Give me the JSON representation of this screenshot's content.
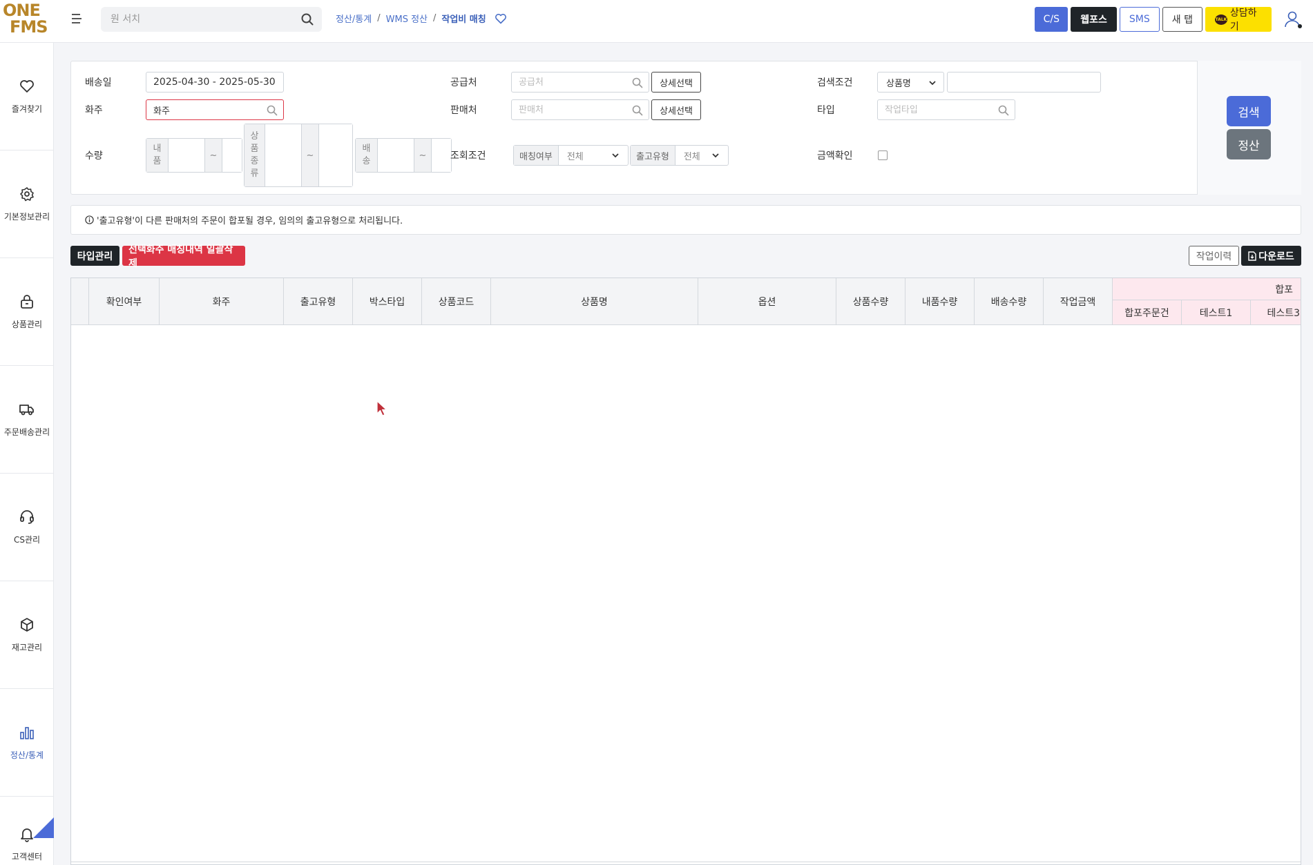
{
  "logo": {
    "line1": "ONE",
    "line2": "FMS"
  },
  "search": {
    "placeholder": "원 서치"
  },
  "breadcrumb": {
    "level1": "정산/통계",
    "level2": "WMS 정산",
    "current": "작업비 매칭",
    "sep": "/"
  },
  "header_buttons": {
    "cs": "C/S",
    "webpos": "웹포스",
    "sms": "SMS",
    "newtab": "새 탭",
    "kakao": "상담하기",
    "kakao_badge": "TALK"
  },
  "sidebar": {
    "items": [
      {
        "label": "즐겨찾기",
        "icon": "heart-icon"
      },
      {
        "label": "기본정보관리",
        "icon": "gear-icon"
      },
      {
        "label": "상품관리",
        "icon": "lock-bag-icon"
      },
      {
        "label": "주문배송관리",
        "icon": "truck-icon"
      },
      {
        "label": "CS관리",
        "icon": "headset-icon"
      },
      {
        "label": "재고관리",
        "icon": "box-icon"
      },
      {
        "label": "정산/통계",
        "icon": "bar-chart-icon",
        "active": true
      },
      {
        "label": "고객센터",
        "icon": "bell-icon"
      }
    ]
  },
  "filters": {
    "ship_date_label": "배송일",
    "ship_date_value": "2025-04-30 - 2025-05-30",
    "owner_label": "화주",
    "owner_value": "화주",
    "qty_label": "수량",
    "qty_return": "내품",
    "qty_product_kind": "상품종류",
    "qty_ship": "배송",
    "tilde": "~",
    "supplier_label": "공급처",
    "supplier_placeholder": "공급처",
    "seller_label": "판매처",
    "seller_placeholder": "판매처",
    "detail_select": "상세선택",
    "query_label": "조회조건",
    "matching_label": "매칭여부",
    "matching_value": "전체",
    "out_type_label": "출고유형",
    "out_type_value": "전체",
    "search_cond_label": "검색조건",
    "search_cond_value": "상품명",
    "type_label": "타입",
    "type_placeholder": "작업타입",
    "amount_check_label": "금액확인"
  },
  "actions": {
    "search": "검색",
    "settle": "정산"
  },
  "notice": "'출고유형'이 다른 판매처의 주문이 합포될 경우, 임의의 출고유형으로 처리됩니다.",
  "toolbar": {
    "type_mgmt": "타입관리",
    "bulk_delete": "선택화주 매칭내역 일괄삭제",
    "history": "작업이력",
    "download": "다운로드"
  },
  "table": {
    "headers": [
      "확인여부",
      "화주",
      "출고유형",
      "박스타입",
      "상품코드",
      "상품명",
      "옵션",
      "상품수량",
      "내품수량",
      "배송수량",
      "작업금액"
    ],
    "group_header": "합포",
    "sub_headers": [
      "합포주문건",
      "테스트1",
      "테스트3"
    ]
  }
}
